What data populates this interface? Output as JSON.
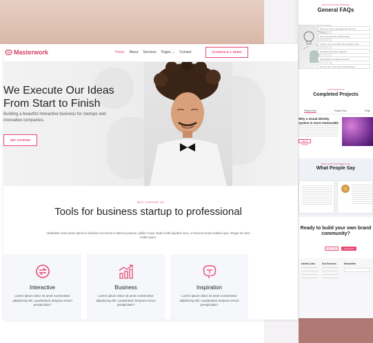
{
  "brand": {
    "name": "Masterwork",
    "accent": "#e6476f"
  },
  "nav": {
    "links": [
      "Home",
      "About",
      "Services",
      "Pages",
      "Contact"
    ],
    "pages_chevron": "⌄",
    "cta": "SCHEDULE A DEMO"
  },
  "hero": {
    "title": "We Execute Our Ideas From Start to Finish",
    "subtitle": "Building a beautiful interactive business for startups and innovative companies.",
    "button": "GET STARTED"
  },
  "why": {
    "eyebrow": "WHY CHOOSE US",
    "title": "Tools for business startup to professional",
    "text": "Vestibulum ante ipsum primis in faucibus orci luctus et ultrices posuere cubilia Curae; Nulla mollis dapibus nunc, ut rhoncus turpis sodales quis. Integer sit amet mattis quam."
  },
  "features": [
    {
      "icon": "arrows-swap-icon",
      "title": "Interactive",
      "text": "Lorem ipsum dolor sit amet consectetur adipisicing elit. Laudantium tempora rerum perspiciatis?"
    },
    {
      "icon": "growth-chart-icon",
      "title": "Business",
      "text": "Lorem ipsum dolor sit amet consectetur adipisicing elit. Laudantium tempora rerum perspiciatis?"
    },
    {
      "icon": "brain-idea-icon",
      "title": "Inspiration",
      "text": "Lorem ipsum dolor sit amet consectetur adipisicing elit. Laudantium tempora rerum perspiciatis?"
    }
  ],
  "preview": {
    "faq_eyebrow": "QUESTIONS AND ANSWERS",
    "faq_title": "General FAQs",
    "faq_items": [
      "There are many passages like this one",
      "Isn't a prosperous small remote?",
      "Is there one more about this question you?",
      "Pell discrimina dolor sapiens?",
      "Quispellitas orci alias sed nunc?",
      "Do you care more about this question?"
    ],
    "projects_eyebrow": "OUR PORTFOLIO",
    "projects_title": "Completed Projects",
    "project_tabs": [
      "Project One",
      "Project Two",
      "Proje"
    ],
    "project_heading": "Why a visual identity system is more memorable",
    "project_button": "READ MORE",
    "testimonials_eyebrow": "WHAT OUR CUSTOMERS SAY",
    "testimonials_title": "What People Say",
    "cta_title": "Ready to build your own brand community?",
    "cta_btn_1": "Learn more",
    "cta_btn_2": "Get started",
    "footer_cols": [
      "Useful Links",
      "Our Services",
      "Newsletter"
    ]
  }
}
